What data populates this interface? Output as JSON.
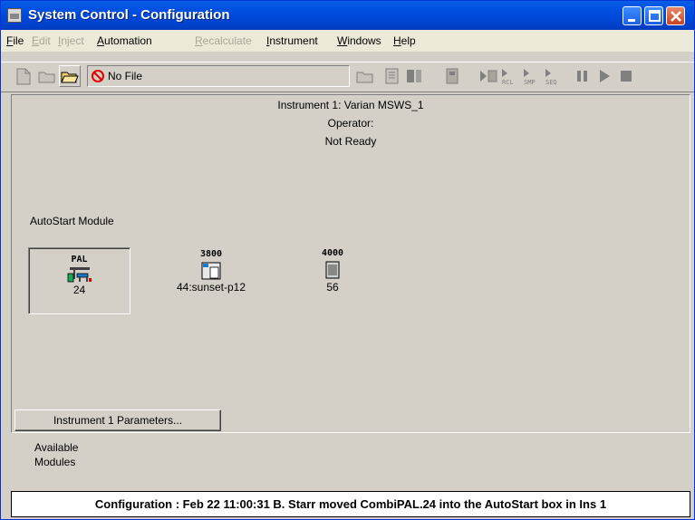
{
  "window": {
    "title": "System Control - Configuration"
  },
  "menu": [
    {
      "label": "File",
      "enabled": true,
      "accel": "F",
      "rest": "ile"
    },
    {
      "label": "Edit",
      "enabled": false,
      "accel": "E",
      "rest": "dit"
    },
    {
      "label": "Inject",
      "enabled": false,
      "accel": "I",
      "rest": "nject"
    },
    {
      "label": "Automation",
      "enabled": true,
      "accel": "A",
      "rest": "utomation"
    },
    {
      "label": "Recalculate",
      "enabled": false,
      "accel": "R",
      "rest": "ecalculate"
    },
    {
      "label": "Instrument",
      "enabled": true,
      "accel": "I",
      "rest": "nstrument"
    },
    {
      "label": "Windows",
      "enabled": true,
      "accel": "W",
      "rest": "indows"
    },
    {
      "label": "Help",
      "enabled": true,
      "accel": "H",
      "rest": "elp"
    }
  ],
  "toolbar": {
    "file_status": "No File",
    "rcl_label": "RCL",
    "smp_label": "SMP",
    "seq_label": "SEQ"
  },
  "instrument": {
    "name_line": "Instrument 1: Varian MSWS_1",
    "operator_line": "Operator:",
    "status_line": "Not Ready"
  },
  "autostart": {
    "label": "AutoStart Module"
  },
  "modules": [
    {
      "title": "PAL",
      "caption": "24",
      "selected": true
    },
    {
      "title": "3800",
      "caption": "44:sunset-p12",
      "selected": false
    },
    {
      "title": "4000",
      "caption": "56",
      "selected": false
    }
  ],
  "params_button": "Instrument 1 Parameters...",
  "available": {
    "line1": "Available",
    "line2": "Modules"
  },
  "statusbar": {
    "text": "Configuration : Feb 22 11:00:31  B. Starr moved CombiPAL.24 into the AutoStart box in Ins 1"
  },
  "colors": {
    "title_blue": "#0054E3",
    "no_file_red": "#E00000",
    "accent_green": "#1aa85a"
  }
}
